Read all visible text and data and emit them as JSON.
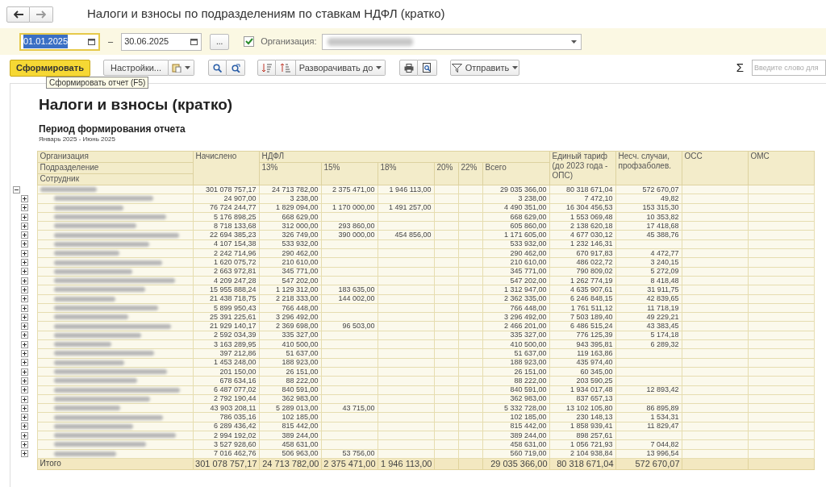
{
  "window": {
    "title": "Налоги и взносы по подразделениям по ставкам НДФЛ (кратко)"
  },
  "filters": {
    "date_from": "01.01.2025",
    "date_separator": "–",
    "date_to": "30.06.2025",
    "more_button": "...",
    "org_checked": true,
    "org_label": "Организация:"
  },
  "toolbar": {
    "generate": "Сформировать",
    "settings": "Настройки...",
    "expand_to": "Разворачивать до",
    "send": "Отправить",
    "sum_symbol": "Σ",
    "search_placeholder": "Введите слово для"
  },
  "tooltip": "Сформировать отчет (F5)",
  "report": {
    "title": "Налоги и взносы (кратко)",
    "subtitle": "Период формирования отчета",
    "period": "Январь 2025 - Июнь 2025",
    "header": {
      "org": "Организация",
      "dept": "Подразделение",
      "employee": "Сотрудник",
      "accrued": "Начислено",
      "ndfl": "НДФЛ",
      "ndfl_13": "13%",
      "ndfl_15": "15%",
      "ndfl_18": "18%",
      "ndfl_20": "20%",
      "ndfl_22": "22%",
      "total": "Всего",
      "unified": "Единый тариф (до 2023 года - ОПС)",
      "accident": "Несч. случаи, профзаболев.",
      "oss": "ОСС",
      "oms": "ОМС"
    },
    "group": {
      "expanded": true,
      "accrued": "301 078 757,17",
      "ndfl_13": "24 713 782,00",
      "ndfl_15": "2 375 471,00",
      "ndfl_18": "1 946 113,00",
      "total": "29 035 366,00",
      "unified": "80 318 671,04",
      "accident": "572 670,07"
    },
    "rows": [
      {
        "expanded": false,
        "accrued": "24 907,00",
        "ndfl_13": "3 238,00",
        "total": "3 238,00",
        "unified": "7 472,10",
        "accident": "49,82"
      },
      {
        "expanded": false,
        "accrued": "76 724 244,77",
        "ndfl_13": "1 829 094,00",
        "ndfl_15": "1 170 000,00",
        "ndfl_18": "1 491 257,00",
        "total": "4 490 351,00",
        "unified": "16 304 456,53",
        "accident": "153 315,30"
      },
      {
        "expanded": false,
        "accrued": "5 176 898,25",
        "ndfl_13": "668 629,00",
        "total": "668 629,00",
        "unified": "1 553 069,48",
        "accident": "10 353,82"
      },
      {
        "expanded": false,
        "accrued": "8 718 133,68",
        "ndfl_13": "312 000,00",
        "ndfl_15": "293 860,00",
        "total": "605 860,00",
        "unified": "2 138 620,18",
        "accident": "17 418,68"
      },
      {
        "expanded": false,
        "accrued": "22 694 385,23",
        "ndfl_13": "326 749,00",
        "ndfl_15": "390 000,00",
        "ndfl_18": "454 856,00",
        "total": "1 171 605,00",
        "unified": "4 677 030,12",
        "accident": "45 388,76"
      },
      {
        "expanded": false,
        "accrued": "4 107 154,38",
        "ndfl_13": "533 932,00",
        "total": "533 932,00",
        "unified": "1 232 146,31"
      },
      {
        "expanded": false,
        "accrued": "2 242 714,96",
        "ndfl_13": "290 462,00",
        "total": "290 462,00",
        "unified": "670 917,83",
        "accident": "4 472,77"
      },
      {
        "expanded": false,
        "accrued": "1 620 075,72",
        "ndfl_13": "210 610,00",
        "total": "210 610,00",
        "unified": "486 022,72",
        "accident": "3 240,15"
      },
      {
        "expanded": false,
        "accrued": "2 663 972,81",
        "ndfl_13": "345 771,00",
        "total": "345 771,00",
        "unified": "790 809,02",
        "accident": "5 272,09"
      },
      {
        "expanded": false,
        "accrued": "4 209 247,28",
        "ndfl_13": "547 202,00",
        "total": "547 202,00",
        "unified": "1 262 774,19",
        "accident": "8 418,48"
      },
      {
        "expanded": false,
        "accrued": "15 955 888,24",
        "ndfl_13": "1 129 312,00",
        "ndfl_15": "183 635,00",
        "total": "1 312 947,00",
        "unified": "4 635 907,61",
        "accident": "31 911,75"
      },
      {
        "expanded": false,
        "accrued": "21 438 718,75",
        "ndfl_13": "2 218 333,00",
        "ndfl_15": "144 002,00",
        "total": "2 362 335,00",
        "unified": "6 246 848,15",
        "accident": "42 839,65"
      },
      {
        "expanded": false,
        "accrued": "5 899 950,43",
        "ndfl_13": "766 448,00",
        "total": "766 448,00",
        "unified": "1 761 511,12",
        "accident": "11 718,19"
      },
      {
        "expanded": false,
        "accrued": "25 391 225,61",
        "ndfl_13": "3 296 492,00",
        "total": "3 296 492,00",
        "unified": "7 503 189,40",
        "accident": "49 229,21"
      },
      {
        "expanded": false,
        "accrued": "21 929 140,17",
        "ndfl_13": "2 369 698,00",
        "ndfl_15": "96 503,00",
        "total": "2 466 201,00",
        "unified": "6 486 515,24",
        "accident": "43 383,45"
      },
      {
        "expanded": false,
        "accrued": "2 592 034,39",
        "ndfl_13": "335 327,00",
        "total": "335 327,00",
        "unified": "776 125,39",
        "accident": "5 174,18"
      },
      {
        "expanded": false,
        "accrued": "3 163 289,95",
        "ndfl_13": "410 500,00",
        "total": "410 500,00",
        "unified": "943 395,81",
        "accident": "6 289,32"
      },
      {
        "expanded": false,
        "accrued": "397 212,86",
        "ndfl_13": "51 637,00",
        "total": "51 637,00",
        "unified": "119 163,86"
      },
      {
        "expanded": false,
        "accrued": "1 453 248,00",
        "ndfl_13": "188 923,00",
        "total": "188 923,00",
        "unified": "435 974,40"
      },
      {
        "expanded": false,
        "accrued": "201 150,00",
        "ndfl_13": "26 151,00",
        "total": "26 151,00",
        "unified": "60 345,00"
      },
      {
        "expanded": false,
        "accrued": "678 634,16",
        "ndfl_13": "88 222,00",
        "total": "88 222,00",
        "unified": "203 590,25"
      },
      {
        "expanded": false,
        "accrued": "6 487 077,02",
        "ndfl_13": "840 591,00",
        "total": "840 591,00",
        "unified": "1 934 017,48",
        "accident": "12 893,42"
      },
      {
        "expanded": false,
        "accrued": "2 792 190,44",
        "ndfl_13": "362 983,00",
        "total": "362 983,00",
        "unified": "837 657,13"
      },
      {
        "expanded": false,
        "accrued": "43 903 208,11",
        "ndfl_13": "5 289 013,00",
        "ndfl_15": "43 715,00",
        "total": "5 332 728,00",
        "unified": "13 102 105,80",
        "accident": "86 895,89"
      },
      {
        "expanded": false,
        "accrued": "786 035,16",
        "ndfl_13": "102 185,00",
        "total": "102 185,00",
        "unified": "230 148,13",
        "accident": "1 534,31"
      },
      {
        "expanded": false,
        "accrued": "6 289 436,42",
        "ndfl_13": "815 442,00",
        "total": "815 442,00",
        "unified": "1 858 939,41",
        "accident": "11 829,47"
      },
      {
        "expanded": false,
        "accrued": "2 994 192,02",
        "ndfl_13": "389 244,00",
        "total": "389 244,00",
        "unified": "898 257,61"
      },
      {
        "expanded": false,
        "accrued": "3 527 928,60",
        "ndfl_13": "458 631,00",
        "total": "458 631,00",
        "unified": "1 056 721,93",
        "accident": "7 044,82"
      },
      {
        "expanded": false,
        "accrued": "7 016 462,76",
        "ndfl_13": "506 963,00",
        "ndfl_15": "53 756,00",
        "total": "560 719,00",
        "unified": "2 104 938,84",
        "accident": "13 996,54"
      }
    ],
    "totals": {
      "label": "Итого",
      "accrued": "301 078 757,17",
      "ndfl_13": "24 713 782,00",
      "ndfl_15": "2 375 471,00",
      "ndfl_18": "1 946 113,00",
      "total": "29 035 366,00",
      "unified": "80 318 671,04",
      "accident": "572 670,07"
    }
  }
}
